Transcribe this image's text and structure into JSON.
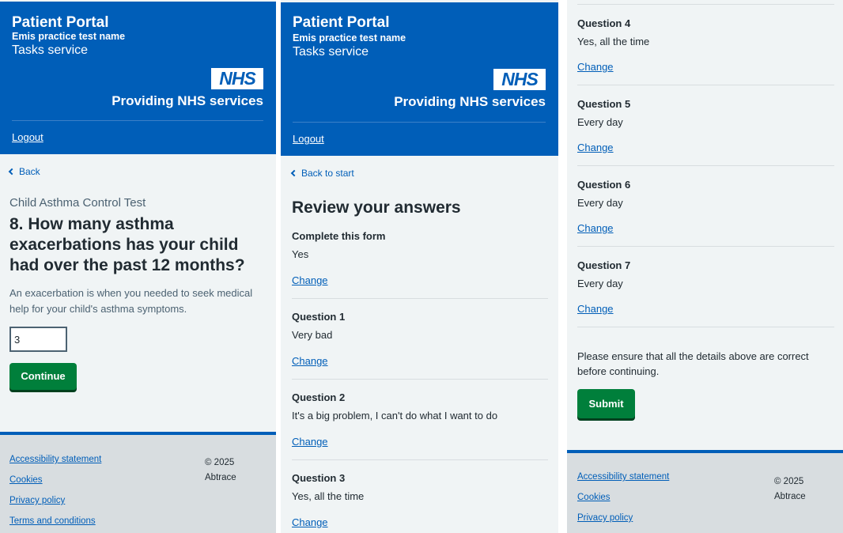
{
  "header": {
    "title": "Patient Portal",
    "practice": "Emis practice test name",
    "service": "Tasks service",
    "nhs_logo": "NHS",
    "providing": "Providing NHS services",
    "logout": "Logout",
    "brand_color": "#005eb8"
  },
  "question_page": {
    "back": "Back",
    "caption": "Child Asthma Control Test",
    "question": "8. How many asthma exacerbations has your child had over the past 12 months?",
    "hint": "An exacerbation is when you needed to seek medical help for your child's asthma symptoms.",
    "answer_value": "3",
    "continue": "Continue"
  },
  "review_page": {
    "back": "Back to start",
    "title": "Review your answers",
    "change_label": "Change",
    "rows": [
      {
        "key": "Complete this form",
        "value": "Yes"
      },
      {
        "key": "Question 1",
        "value": "Very bad"
      },
      {
        "key": "Question 2",
        "value": "It's a big problem, I can't do what I want to do"
      },
      {
        "key": "Question 3",
        "value": "Yes, all the time"
      },
      {
        "key": "Question 4",
        "value": "Yes, all the time"
      },
      {
        "key": "Question 5",
        "value": "Every day"
      },
      {
        "key": "Question 6",
        "value": "Every day"
      },
      {
        "key": "Question 7",
        "value": "Every day"
      }
    ],
    "notice": "Please ensure that all the details above are correct before continuing.",
    "submit": "Submit"
  },
  "footer": {
    "links": [
      "Accessibility statement",
      "Cookies",
      "Privacy policy",
      "Terms and conditions"
    ],
    "copyright": "© 2025",
    "company": "Abtrace"
  }
}
